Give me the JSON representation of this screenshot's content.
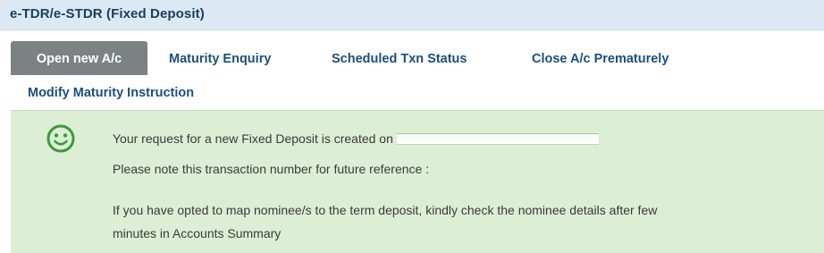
{
  "header": {
    "title": "e-TDR/e-STDR (Fixed Deposit)"
  },
  "tabs": [
    {
      "label": "Open new A/c",
      "active": true
    },
    {
      "label": "Maturity Enquiry",
      "active": false
    },
    {
      "label": "Scheduled Txn Status",
      "active": false
    },
    {
      "label": "Close A/c Prematurely",
      "active": false
    },
    {
      "label": "Modify Maturity Instruction",
      "active": false
    }
  ],
  "message": {
    "icon": "smiley-icon",
    "line1": "Your request for a new Fixed Deposit is created on",
    "line2": "Please note this transaction number for future reference :",
    "line3": "If you have opted to map nominee/s to the term deposit, kindly check the nominee details after few",
    "line4": "minutes in Accounts Summary"
  },
  "colors": {
    "title_bar_bg": "#dce9f4",
    "title_text": "#17405f",
    "tab_text": "#1c4f7c",
    "active_tab_bg": "#7c8283",
    "success_panel_bg": "#dceed4",
    "smiley_green": "#3c9a3c"
  }
}
